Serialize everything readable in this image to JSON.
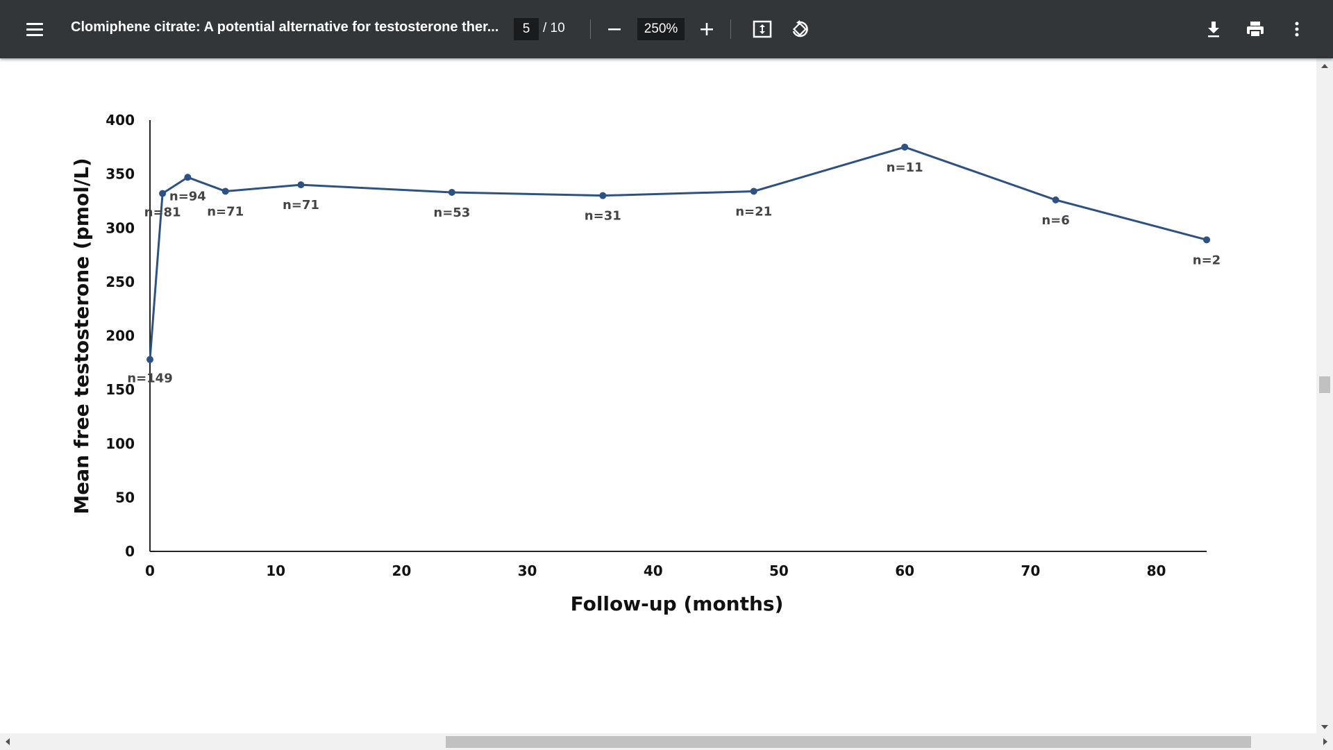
{
  "toolbar": {
    "title": "Clomiphene citrate: A potential alternative for testosterone ther...",
    "page_current": "5",
    "page_total": "/ 10",
    "zoom": "250%"
  },
  "chart_data": {
    "type": "line",
    "xlabel": "Follow-up (months)",
    "ylabel": "Mean free testosterone (pmol/L)",
    "xlim": [
      0,
      84
    ],
    "ylim": [
      0,
      400
    ],
    "x_ticks": [
      0,
      10,
      20,
      30,
      40,
      50,
      60,
      70,
      80
    ],
    "y_ticks": [
      0,
      50,
      100,
      150,
      200,
      250,
      300,
      350,
      400
    ],
    "line_color": "#2e5183",
    "points": [
      {
        "x": 0,
        "y": 178,
        "label": "n=149"
      },
      {
        "x": 1,
        "y": 332,
        "label": "n=81"
      },
      {
        "x": 3,
        "y": 347,
        "label": "n=94"
      },
      {
        "x": 6,
        "y": 334,
        "label": "n=71"
      },
      {
        "x": 12,
        "y": 340,
        "label": "n=71"
      },
      {
        "x": 24,
        "y": 333,
        "label": "n=53"
      },
      {
        "x": 36,
        "y": 330,
        "label": "n=31"
      },
      {
        "x": 48,
        "y": 334,
        "label": "n=21"
      },
      {
        "x": 60,
        "y": 375,
        "label": "n=11"
      },
      {
        "x": 72,
        "y": 326,
        "label": "n=6"
      },
      {
        "x": 84,
        "y": 289,
        "label": "n=2"
      }
    ]
  }
}
